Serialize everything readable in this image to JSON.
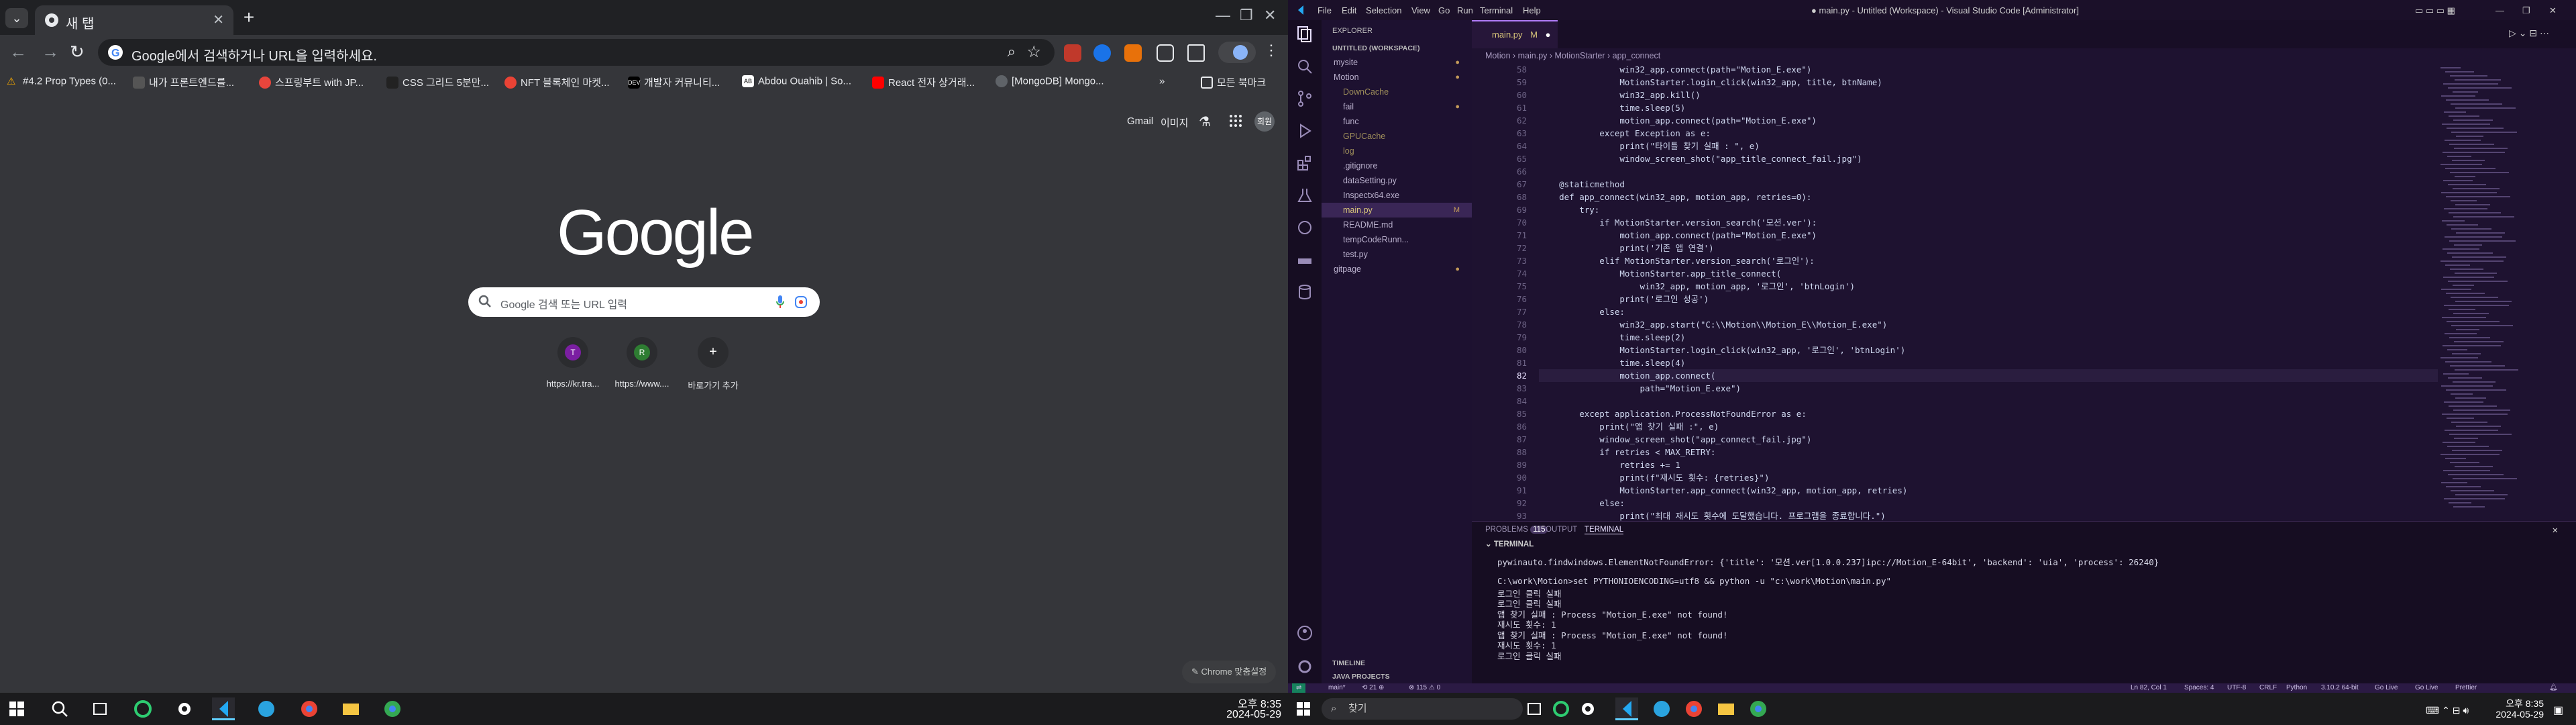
{
  "chrome": {
    "tab_title": "새 탭",
    "new_tab": "+",
    "omnibox_text": "Google에서 검색하거나 URL을 입력하세요.",
    "bookmarks": [
      {
        "label": "#4.2 Prop Types (0...",
        "color": "#f9ab00"
      },
      {
        "label": "내가 프론트엔드를...",
        "color": "#1a1a1a"
      },
      {
        "label": "스프링부트 with JP...",
        "color": "#e8453c"
      },
      {
        "label": "CSS 그리드 5분만...",
        "color": "#222222"
      },
      {
        "label": "NFT 블록체인 마켓...",
        "color": "#ea4335"
      },
      {
        "label": "개발자 커뮤니티...",
        "color": "#000000"
      },
      {
        "label": "Abdou Ouahib | So...",
        "color": "#ffffff"
      },
      {
        "label": "React 전자 상거래...",
        "color": "#ff0000"
      },
      {
        "label": "[MongoDB] Mongo...",
        "color": "#5f6368"
      }
    ],
    "bookmarks_folder": "모든 북마크",
    "ntp_links": [
      "Gmail",
      "이미지"
    ],
    "logo": "Google",
    "search_placeholder": "Google 검색 또는 URL 입력",
    "shortcuts": [
      {
        "label": "https://kr.tra...",
        "letter": "T",
        "color": "#7b1fa2"
      },
      {
        "label": "https://www....",
        "letter": "R",
        "color": "#2e7d32"
      },
      {
        "label": "바로가기 추가",
        "letter": "+",
        "color": "#2b2c2f"
      }
    ],
    "customize": "Chrome 맞춤설정",
    "avatar_text": "회원"
  },
  "taskbar_left": {
    "time": "오후 8:35",
    "date": "2024-05-29"
  },
  "vscode": {
    "title": "● main.py - Untitled (Workspace) - Visual Studio Code [Administrator]",
    "menu": [
      "File",
      "Edit",
      "Selection",
      "View",
      "Go",
      "Run",
      "Terminal",
      "Help"
    ],
    "explorer_header": "EXPLORER",
    "workspace": "UNTITLED (WORKSPACE)",
    "tree": [
      {
        "label": "mysite",
        "indent": 1,
        "color": "#b9b0cc",
        "marker": "●"
      },
      {
        "label": "Motion",
        "indent": 1,
        "color": "#b9b0cc",
        "marker": "●"
      },
      {
        "label": "DownCache",
        "indent": 2,
        "color": "#9d8d5a",
        "marker": ""
      },
      {
        "label": "fail",
        "indent": 2,
        "color": "#b9b0cc",
        "marker": "●"
      },
      {
        "label": "func",
        "indent": 2,
        "color": "#b9b0cc",
        "marker": ""
      },
      {
        "label": "GPUCache",
        "indent": 2,
        "color": "#9d8d5a",
        "marker": ""
      },
      {
        "label": "log",
        "indent": 2,
        "color": "#9d8d5a",
        "marker": ""
      },
      {
        "label": ".gitignore",
        "indent": 2,
        "color": "#b9b0cc",
        "marker": ""
      },
      {
        "label": "dataSetting.py",
        "indent": 2,
        "color": "#b9b0cc",
        "marker": ""
      },
      {
        "label": "Inspectx64.exe",
        "indent": 2,
        "color": "#b9b0cc",
        "marker": ""
      },
      {
        "label": "main.py",
        "indent": 2,
        "color": "#d8c57a",
        "marker": "M"
      },
      {
        "label": "README.md",
        "indent": 2,
        "color": "#b9b0cc",
        "marker": ""
      },
      {
        "label": "tempCodeRunn...",
        "indent": 2,
        "color": "#b9b0cc",
        "marker": ""
      },
      {
        "label": "test.py",
        "indent": 2,
        "color": "#b9b0cc",
        "marker": ""
      },
      {
        "label": "gitpage",
        "indent": 1,
        "color": "#b9b0cc",
        "marker": "●"
      }
    ],
    "timeline": "TIMELINE",
    "java_projects": "JAVA PROJECTS",
    "editor_tab": "main.py",
    "editor_tab_mark": "M",
    "breadcrumb": "Motion  ›  main.py  ›  MotionStarter  ›  app_connect",
    "code_lines": [
      {
        "n": "58",
        "c": "                win32_app.connect(path=\"Motion_E.exe\")"
      },
      {
        "n": "59",
        "c": "                MotionStarter.login_click(win32_app, title, btnName)"
      },
      {
        "n": "60",
        "c": "                win32_app.kill()"
      },
      {
        "n": "61",
        "c": "                time.sleep(5)"
      },
      {
        "n": "62",
        "c": "                motion_app.connect(path=\"Motion_E.exe\")"
      },
      {
        "n": "63",
        "c": "            except Exception as e:"
      },
      {
        "n": "64",
        "c": "                print(\"타이틀 찾기 실패 : \", e)"
      },
      {
        "n": "65",
        "c": "                window_screen_shot(\"app_title_connect_fail.jpg\")"
      },
      {
        "n": "66",
        "c": ""
      },
      {
        "n": "67",
        "c": "    @staticmethod"
      },
      {
        "n": "68",
        "c": "    def app_connect(win32_app, motion_app, retries=0):"
      },
      {
        "n": "69",
        "c": "        try:"
      },
      {
        "n": "70",
        "c": "            if MotionStarter.version_search('모션.ver'):"
      },
      {
        "n": "71",
        "c": "                motion_app.connect(path=\"Motion_E.exe\")"
      },
      {
        "n": "72",
        "c": "                print('기존 앱 연결')"
      },
      {
        "n": "73",
        "c": "            elif MotionStarter.version_search('로그인'):"
      },
      {
        "n": "74",
        "c": "                MotionStarter.app_title_connect("
      },
      {
        "n": "75",
        "c": "                    win32_app, motion_app, '로그인', 'btnLogin')"
      },
      {
        "n": "76",
        "c": "                print('로그인 성공')"
      },
      {
        "n": "77",
        "c": "            else:"
      },
      {
        "n": "78",
        "c": "                win32_app.start(\"C:\\\\Motion\\\\Motion_E\\\\Motion_E.exe\")"
      },
      {
        "n": "79",
        "c": "                time.sleep(2)"
      },
      {
        "n": "80",
        "c": "                MotionStarter.login_click(win32_app, '로그인', 'btnLogin')"
      },
      {
        "n": "81",
        "c": "                time.sleep(4)"
      },
      {
        "n": "82",
        "c": "                motion_app.connect("
      },
      {
        "n": "83",
        "c": "                    path=\"Motion_E.exe\")"
      },
      {
        "n": "84",
        "c": ""
      },
      {
        "n": "85",
        "c": "        except application.ProcessNotFoundError as e:"
      },
      {
        "n": "86",
        "c": "            print(\"앱 찾기 실패 :\", e)"
      },
      {
        "n": "87",
        "c": "            window_screen_shot(\"app_connect_fail.jpg\")"
      },
      {
        "n": "88",
        "c": "            if retries < MAX_RETRY:"
      },
      {
        "n": "89",
        "c": "                retries += 1"
      },
      {
        "n": "90",
        "c": "                print(f\"재시도 횟수: {retries}\")"
      },
      {
        "n": "91",
        "c": "                MotionStarter.app_connect(win32_app, motion_app, retries)"
      },
      {
        "n": "92",
        "c": "            else:"
      },
      {
        "n": "93",
        "c": "                print(\"최대 재시도 횟수에 도달했습니다. 프로그램을 종료합니다.\")"
      }
    ],
    "panel_tabs": {
      "problems": "PROBLEMS",
      "problems_count": "115",
      "output": "OUTPUT",
      "terminal": "TERMINAL"
    },
    "terminal_header": "TERMINAL",
    "terminal_lines": [
      "pywinauto.findwindows.ElementNotFoundError: {'title': '모션.ver[1.0.0.237]ipc://Motion_E-64bit', 'backend': 'uia', 'process': 26240}",
      "",
      "C:\\work\\Motion>set PYTHONIOENCODING=utf8 && python -u \"c:\\work\\Motion\\main.py\"",
      "로그인 클릭 실패",
      "로그인 클릭 실패",
      "앱 찾기 실패 : Process \"Motion_E.exe\" not found!",
      "재시도 횟수: 1",
      "앱 찾기 실패 : Process \"Motion_E.exe\" not found!",
      "재시도 횟수: 1",
      "로그인 클릭 실패",
      ""
    ],
    "status": {
      "branch": "main*",
      "sync": "⟲ 21 ⊕",
      "problems": "⊗ 115 ⚠ 0",
      "cursor": "Ln 82, Col 1",
      "spaces": "Spaces: 4",
      "encoding": "UTF-8",
      "eol": "CRLF",
      "lang": "Python",
      "python": "3.10.2 64-bit",
      "golive": "Go Live",
      "golive2": "Go Live",
      "prettier": "Prettier"
    }
  },
  "taskbar_right": {
    "search": "찾기",
    "time": "오후 8:35",
    "date": "2024-05-29"
  }
}
